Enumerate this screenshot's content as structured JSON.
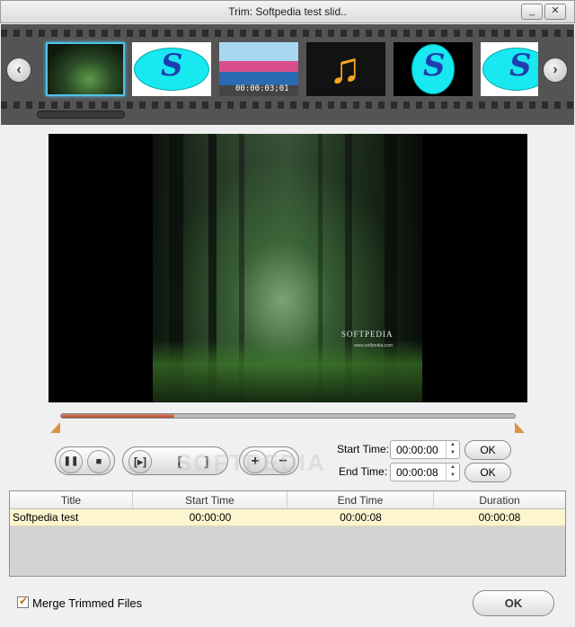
{
  "window": {
    "title": "Trim: Softpedia test slid..",
    "minimize": "_",
    "close": "✕"
  },
  "filmstrip": {
    "prev": "‹",
    "next": "›",
    "thumbnails": [
      {
        "kind": "forest",
        "selected": true
      },
      {
        "kind": "softpedia-s",
        "letter": "S"
      },
      {
        "kind": "video",
        "timecode": "00:00:03;01"
      },
      {
        "kind": "music"
      },
      {
        "kind": "softpedia-s",
        "letter": "S"
      },
      {
        "kind": "softpedia-s",
        "letter": "S"
      }
    ],
    "music_glyph": "♫"
  },
  "preview": {
    "watermark": "SOFTPEDIA",
    "watermark_sub": "www.softpedia.com"
  },
  "timeline": {
    "progress": 0.25
  },
  "controls": {
    "pause": "❚❚",
    "stop": "■",
    "play_segment": "[▸]",
    "mark_in": "[",
    "mark_out": "]",
    "add": "+",
    "remove": "−"
  },
  "start_time": {
    "label": "Start Time:",
    "value": "00:00:00",
    "ok": "OK"
  },
  "end_time": {
    "label": "End Time:",
    "value": "00:00:08",
    "ok": "OK"
  },
  "table": {
    "headers": [
      "Title",
      "Start Time",
      "End Time",
      "Duration"
    ],
    "rows": [
      {
        "title": "Softpedia test",
        "start": "00:00:00",
        "end": "00:00:08",
        "duration": "00:00:08"
      }
    ]
  },
  "merge": {
    "label": "Merge Trimmed Files",
    "checked": true
  },
  "ok_button": "OK",
  "overlay_watermark": "SOFTPEDIA"
}
